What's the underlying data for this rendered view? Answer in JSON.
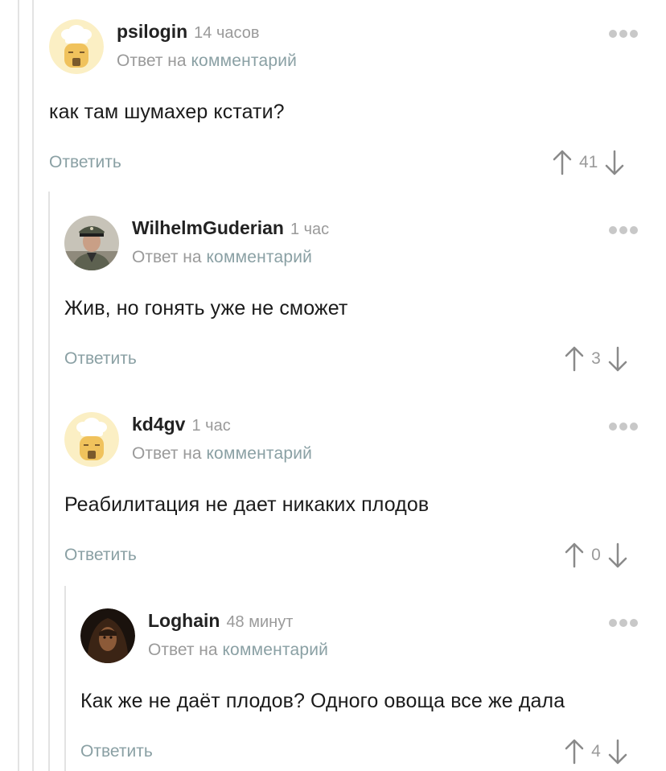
{
  "comments": [
    {
      "author": "psilogin",
      "time": "14 часов",
      "reply_prefix": "Ответ на",
      "reply_link": "комментарий",
      "text": "как там шумахер кстати?",
      "reply_label": "Ответить",
      "votes": "41",
      "avatar": "chef-avatar-icon"
    },
    {
      "author": "WilhelmGuderian",
      "time": "1 час",
      "reply_prefix": "Ответ на",
      "reply_link": "комментарий",
      "text": "Жив, но гонять уже не сможет",
      "reply_label": "Ответить",
      "votes": "3",
      "avatar": "officer-photo-avatar"
    },
    {
      "author": "kd4gv",
      "time": "1 час",
      "reply_prefix": "Ответ на",
      "reply_link": "комментарий",
      "text": "Реабилитация не дает никаких плодов",
      "reply_label": "Ответить",
      "votes": "0",
      "avatar": "chef-avatar-icon"
    },
    {
      "author": "Loghain",
      "time": "48 минут",
      "reply_prefix": "Ответ на",
      "reply_link": "комментарий",
      "text": "Как же не даёт плодов? Одного овоща все же дала",
      "reply_label": "Ответить",
      "votes": "4",
      "avatar": "hooded-figure-avatar"
    }
  ],
  "colors": {
    "accent": "#8aa0a4",
    "muted": "#9a9a9a",
    "thread_line": "#e3e3e3"
  }
}
